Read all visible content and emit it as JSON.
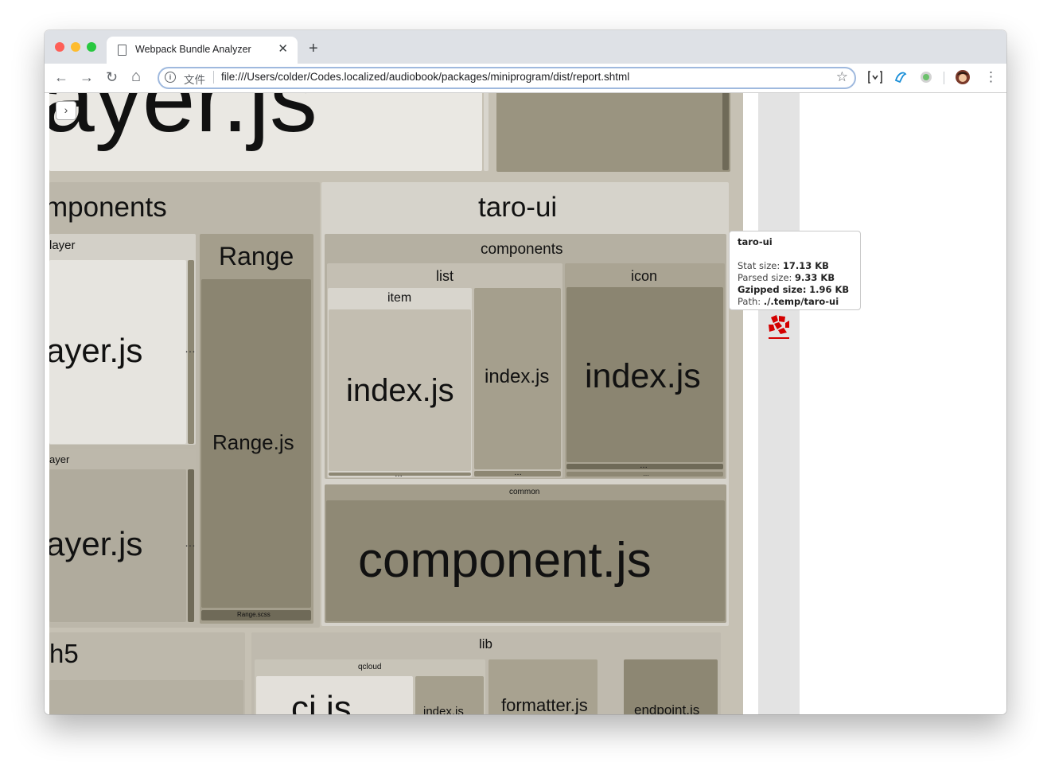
{
  "browser": {
    "tab_title": "Webpack Bundle Analyzer",
    "tab_close": "✕",
    "new_tab": "+",
    "scheme_label": "文件",
    "url": "file:///Users/colder/Codes.localized/audiobook/packages/miniprogram/dist/report.shtml",
    "nav": {
      "back": "←",
      "forward": "→",
      "reload": "↻",
      "home": "⌂"
    },
    "star": "☆",
    "menu": "⋮",
    "traffic_light_colors": [
      "#fe5f57",
      "#febc2e",
      "#28c840"
    ]
  },
  "treemap": {
    "toggle_label": "›",
    "cells": {
      "top_player": "ayer.js",
      "components": "mponents",
      "player1": "layer",
      "player1_file": "ayer.js",
      "player1_more": "…",
      "player2": "ayer",
      "player2_file": "ayer.js",
      "player2_more": "…",
      "range": "Range",
      "range_file": "Range.js",
      "range_scss": "Range.scss",
      "taro_ui": "taro-ui",
      "taro_components": "components",
      "list": "list",
      "item": "item",
      "item_index": "index.js",
      "item_more": "…",
      "list_index": "index.js",
      "list_more": "…",
      "icon": "icon",
      "icon_index": "index.js",
      "icon_more": "…",
      "icon_more2": "…",
      "common": "common",
      "common_file": "component.js",
      "h5": "h5",
      "lib": "lib",
      "qcloud": "qcloud",
      "ci": "ci.js",
      "qcloud_index": "index.js",
      "formatter": "formatter.js",
      "endpoint": "endpoint.js"
    }
  },
  "tooltip": {
    "title": "taro-ui",
    "stat_label": "Stat size:",
    "stat_value": "17.13 KB",
    "parsed_label": "Parsed size:",
    "parsed_value": "9.33 KB",
    "gzip_label": "Gzipped size:",
    "gzip_value": "1.96 KB",
    "path_label": "Path:",
    "path_value": "./.temp/taro-ui"
  },
  "sidebar": {
    "foamtree_logo": "FoamTree"
  }
}
